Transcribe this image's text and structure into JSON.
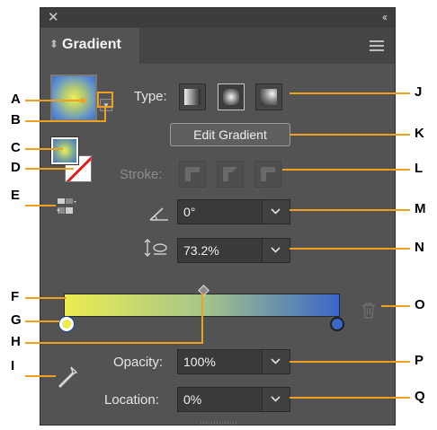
{
  "panel": {
    "tab_label": "Gradient",
    "close_glyph": "✕",
    "collapse_glyph": "‹‹"
  },
  "type_row": {
    "label": "Type:",
    "buttons": [
      "linear-gradient-icon",
      "radial-gradient-icon",
      "freeform-gradient-icon"
    ],
    "active_index": 1
  },
  "edit_gradient_label": "Edit Gradient",
  "stroke_row": {
    "label": "Stroke:"
  },
  "angle": {
    "value": "0°"
  },
  "aspect_ratio": {
    "value": "73.2%"
  },
  "opacity": {
    "label": "Opacity:",
    "value": "100%"
  },
  "location": {
    "label": "Location:",
    "value": "0%"
  },
  "gradient": {
    "start_color": "#ecec4f",
    "end_color": "#3b67c8"
  },
  "callouts": {
    "A": "A",
    "B": "B",
    "C": "C",
    "D": "D",
    "E": "E",
    "F": "F",
    "G": "G",
    "H": "H",
    "I": "I",
    "J": "J",
    "K": "K",
    "L": "L",
    "M": "M",
    "N": "N",
    "O": "O",
    "P": "P",
    "Q": "Q"
  },
  "accent_color": "#f0a020"
}
